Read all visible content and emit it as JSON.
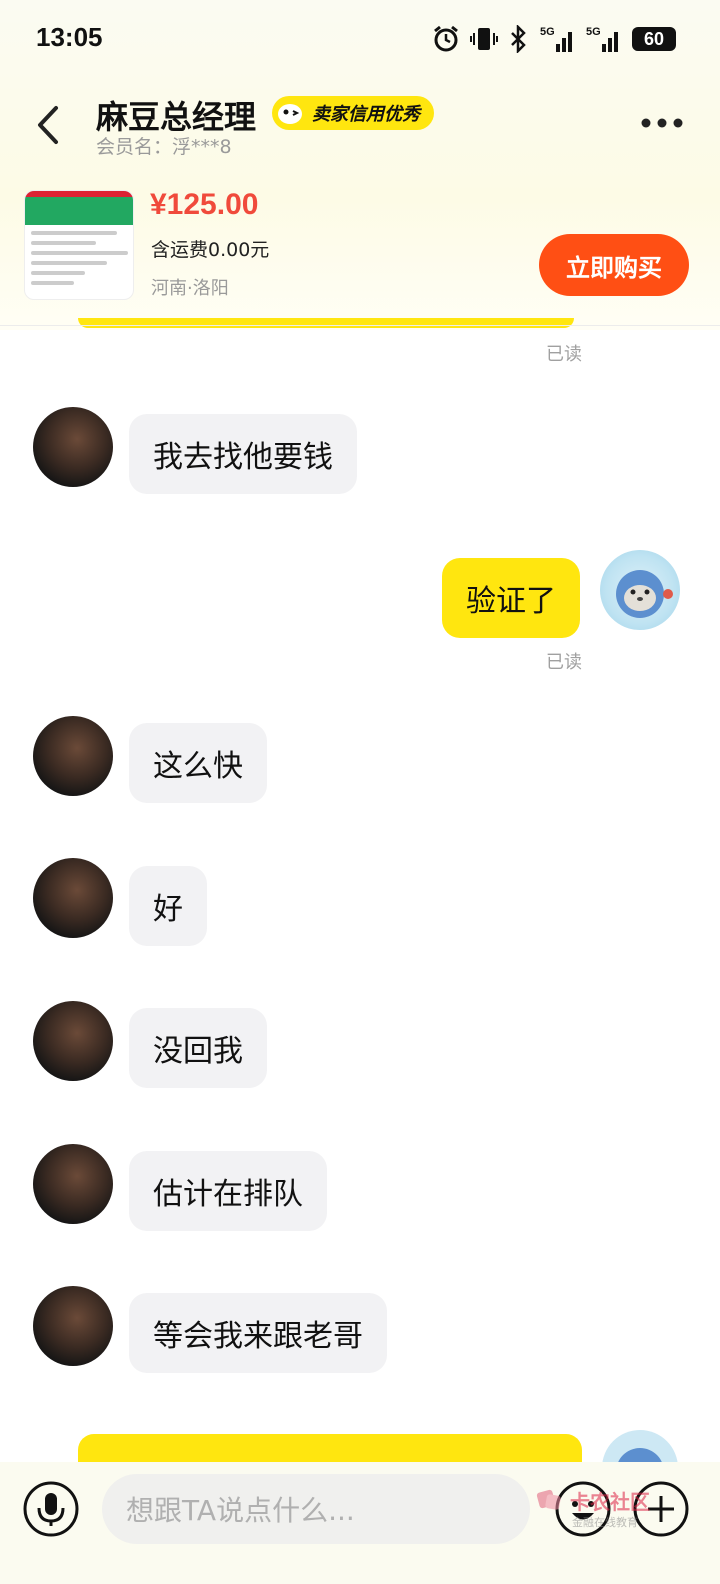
{
  "status_bar": {
    "time": "13:05",
    "battery": "60",
    "signal1": "5G",
    "signal2": "5G",
    "icons": [
      "alarm-icon",
      "vibrate-icon",
      "bluetooth-icon",
      "signal-icon",
      "signal-icon",
      "battery-icon"
    ]
  },
  "header": {
    "title": "麻豆总经理",
    "badge": "卖家信用优秀",
    "member_line": "会员名：浮***8"
  },
  "product": {
    "price": "¥125.00",
    "shipping": "含运费0.00元",
    "location": "河南·洛阳",
    "buy_label": "立即购买"
  },
  "messages": [
    {
      "side": "status",
      "text": "已读"
    },
    {
      "side": "in",
      "text": "我去找他要钱"
    },
    {
      "side": "out",
      "text": "验证了"
    },
    {
      "side": "status",
      "text": "已读"
    },
    {
      "side": "in",
      "text": "这么快"
    },
    {
      "side": "in",
      "text": "好"
    },
    {
      "side": "in",
      "text": "没回我"
    },
    {
      "side": "in",
      "text": "估计在排队"
    },
    {
      "side": "in",
      "text": "等会我来跟老哥"
    }
  ],
  "input": {
    "placeholder": "想跟TA说点什么..."
  },
  "watermark": {
    "text": "卡农社区",
    "sub": "金融在线教育"
  },
  "colors": {
    "accent_yellow": "#ffe60f",
    "buy_orange": "#ff4f14",
    "price_red": "#f04a3b"
  }
}
